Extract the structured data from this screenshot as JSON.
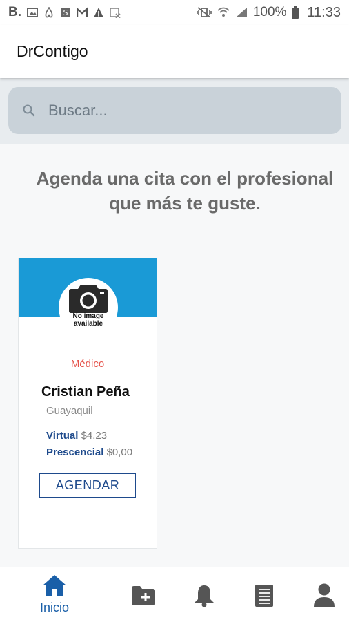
{
  "status_bar": {
    "left_letter": "B.",
    "battery_percent": "100%",
    "time": "11:33"
  },
  "app_bar": {
    "title": "DrContigo"
  },
  "search": {
    "placeholder": "Buscar..."
  },
  "headline": "Agenda una cita con el profesional que más te guste.",
  "cards": [
    {
      "image_text": "No image available",
      "specialty": "Médico",
      "name": "Cristian Peña",
      "city": "Guayaquil",
      "virtual_label": "Virtual",
      "virtual_price": "$4.23",
      "presencial_label": "Prescencial",
      "presencial_price": "$0,00",
      "button_label": "AGENDAR"
    }
  ],
  "bottom_nav": {
    "active_label": "Inicio",
    "items": [
      {
        "icon": "home-icon",
        "label": "Inicio"
      },
      {
        "icon": "folder-add-icon"
      },
      {
        "icon": "bell-icon"
      },
      {
        "icon": "document-list-icon"
      },
      {
        "icon": "user-icon"
      }
    ]
  },
  "colors": {
    "header_blue": "#1a9ad6",
    "accent_navy": "#1e4a8c",
    "specialty_red": "#e5534b",
    "search_bg": "#c9d2d9"
  }
}
